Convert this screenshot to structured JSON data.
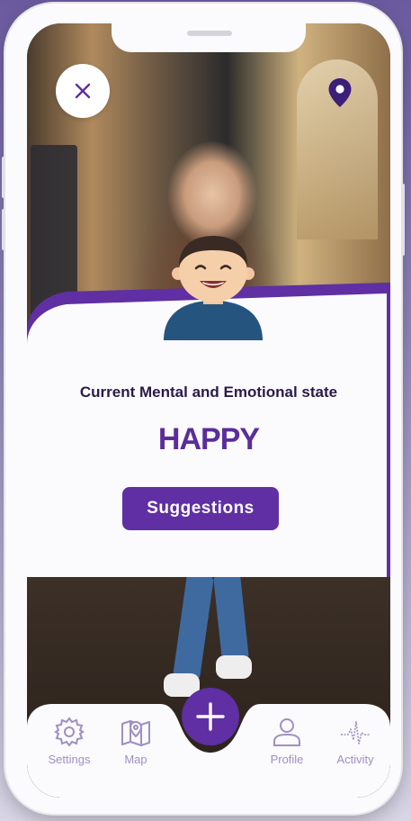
{
  "header": {
    "close_icon": "close-icon",
    "location_icon": "location-pin-icon"
  },
  "mood_card": {
    "state_label": "Current Mental and Emotional state",
    "state_value": "HAPPY",
    "suggestions_label": "Suggestions",
    "avatar_icon": "happy-avatar-icon"
  },
  "tabbar": {
    "fab_icon": "plus-icon",
    "items": [
      {
        "label": "Settings",
        "icon": "gear-icon"
      },
      {
        "label": "Map",
        "icon": "map-icon"
      },
      {
        "label": "Profile",
        "icon": "user-icon"
      },
      {
        "label": "Activity",
        "icon": "activity-icon"
      }
    ]
  },
  "colors": {
    "accent": "#5f2fa3",
    "heading": "#2a1a4a",
    "tab_inactive": "#9f8fc2"
  }
}
